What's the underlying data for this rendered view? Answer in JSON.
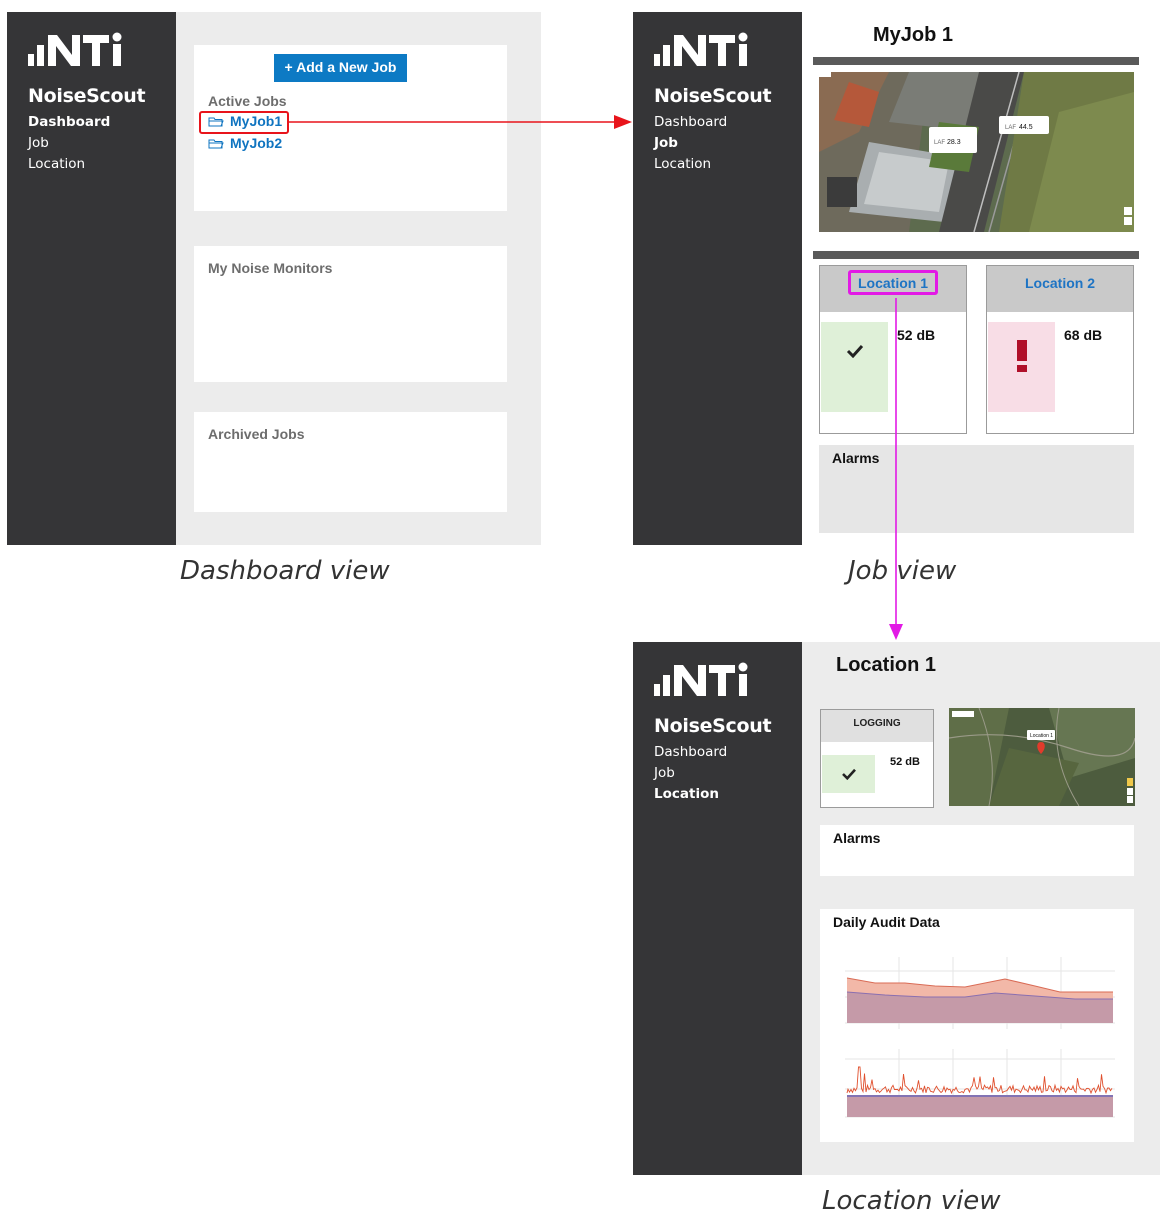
{
  "app": {
    "logo_text": "NTi",
    "brand_bold": "Noise",
    "brand_regular": "Scout",
    "nav": [
      "Dashboard",
      "Job",
      "Location"
    ]
  },
  "dashboard": {
    "add_job_button": "+ Add a New Job",
    "active_jobs_title": "Active Jobs",
    "jobs": [
      "MyJob1",
      "MyJob2"
    ],
    "monitors_title": "My Noise Monitors",
    "archived_title": "Archived Jobs",
    "caption": "Dashboard view"
  },
  "job": {
    "title": "MyJob 1",
    "map_markers": [
      {
        "label": "LAF",
        "value": "28.3"
      },
      {
        "label": "LAF",
        "value": "44.5"
      }
    ],
    "locations": [
      {
        "name": "Location 1",
        "level": "52 dB",
        "status": "ok"
      },
      {
        "name": "Location 2",
        "level": "68 dB",
        "status": "alarm"
      }
    ],
    "alarms_title": "Alarms",
    "caption": "Job view"
  },
  "location": {
    "title": "Location 1",
    "status_label": "LOGGING",
    "level": "52 dB",
    "map_marker": "Location 1",
    "alarms_title": "Alarms",
    "audit_title": "Daily Audit Data",
    "caption": "Location view"
  },
  "colors": {
    "sidebar": "#353537",
    "panel_bg": "#ececec",
    "accent_blue": "#0d7ac4",
    "link_blue": "#0f74c0",
    "ok_green": "#dff0d8",
    "alarm_pink": "#f8dde6",
    "alarm_red": "#b0102a",
    "highlight_red": "#e8141b",
    "highlight_magenta": "#e21ae5"
  },
  "icons": {
    "folder": "folder-icon",
    "check": "checkmark-icon",
    "alarm": "exclamation-icon"
  }
}
